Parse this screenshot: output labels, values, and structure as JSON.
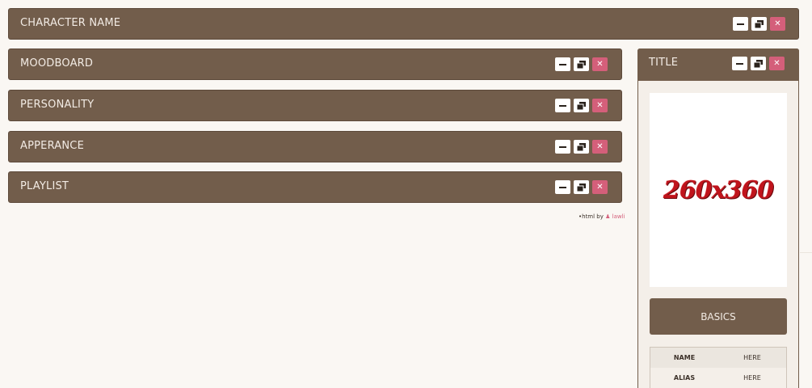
{
  "header": {
    "title": "CHARACTER NAME"
  },
  "sections": [
    {
      "title": "MOODBOARD"
    },
    {
      "title": "PERSONALITY"
    },
    {
      "title": "APPERANCE"
    },
    {
      "title": "PLAYLIST"
    }
  ],
  "window_controls": {
    "minimize_icon": "minimize-icon",
    "restore_icon": "restore-icon",
    "close_icon": "close-icon",
    "close_glyph": "✕",
    "close_color": "#d45f7a"
  },
  "credit": {
    "prefix": "•html by",
    "author": "lawli"
  },
  "side_panel": {
    "title": "TITLE",
    "image_placeholder": "260x360",
    "basics_label": "BASICS",
    "rows": [
      {
        "key": "NAME",
        "value": "HERE"
      },
      {
        "key": "ALIAS",
        "value": "HERE"
      }
    ]
  },
  "colors": {
    "bar": "#725d4b",
    "background": "#faf7f3",
    "accent": "#d45f7a"
  }
}
